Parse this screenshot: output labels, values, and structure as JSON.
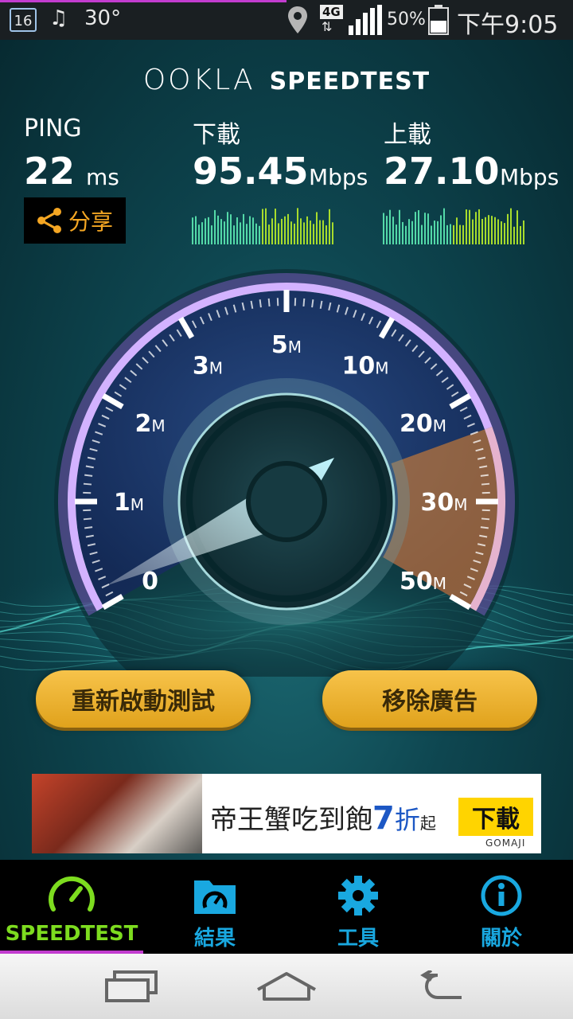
{
  "status_bar": {
    "date_badge": "16",
    "temperature": "30°",
    "network": "4G",
    "battery": "50%",
    "time": "下午9:05"
  },
  "header": {
    "brand_logo": "OOKLA",
    "brand_title": "SPEEDTEST"
  },
  "results": {
    "ping": {
      "label": "PING",
      "value": "22",
      "unit": "ms"
    },
    "download": {
      "label": "下載",
      "value": "95.45",
      "unit": "Mbps"
    },
    "upload": {
      "label": "上載",
      "value": "27.10",
      "unit": "Mbps"
    },
    "share_label": "分享"
  },
  "gauge": {
    "ticks": [
      "0",
      "1M",
      "2M",
      "3M",
      "5M",
      "10M",
      "20M",
      "30M",
      "50M"
    ]
  },
  "buttons": {
    "restart": "重新啟動測試",
    "remove_ads": "移除廣告"
  },
  "ad": {
    "text": "帝王蟹吃到飽",
    "discount_number": "7",
    "discount_word": "折",
    "discount_suffix": "起",
    "cta": "下載",
    "brand": "GOMAJI"
  },
  "tabs": [
    {
      "label": "SPEEDTEST",
      "icon": "speedometer-icon",
      "active": true
    },
    {
      "label": "結果",
      "icon": "folder-gauge-icon",
      "active": false
    },
    {
      "label": "工具",
      "icon": "gear-icon",
      "active": false
    },
    {
      "label": "關於",
      "icon": "info-icon",
      "active": false
    }
  ],
  "colors": {
    "accent_purple": "#c23ccf",
    "button_gold": "#f0b432",
    "tab_active": "#7ddc1f",
    "tab_inactive": "#19a8e0",
    "gauge_orange": "#f08a2c"
  }
}
